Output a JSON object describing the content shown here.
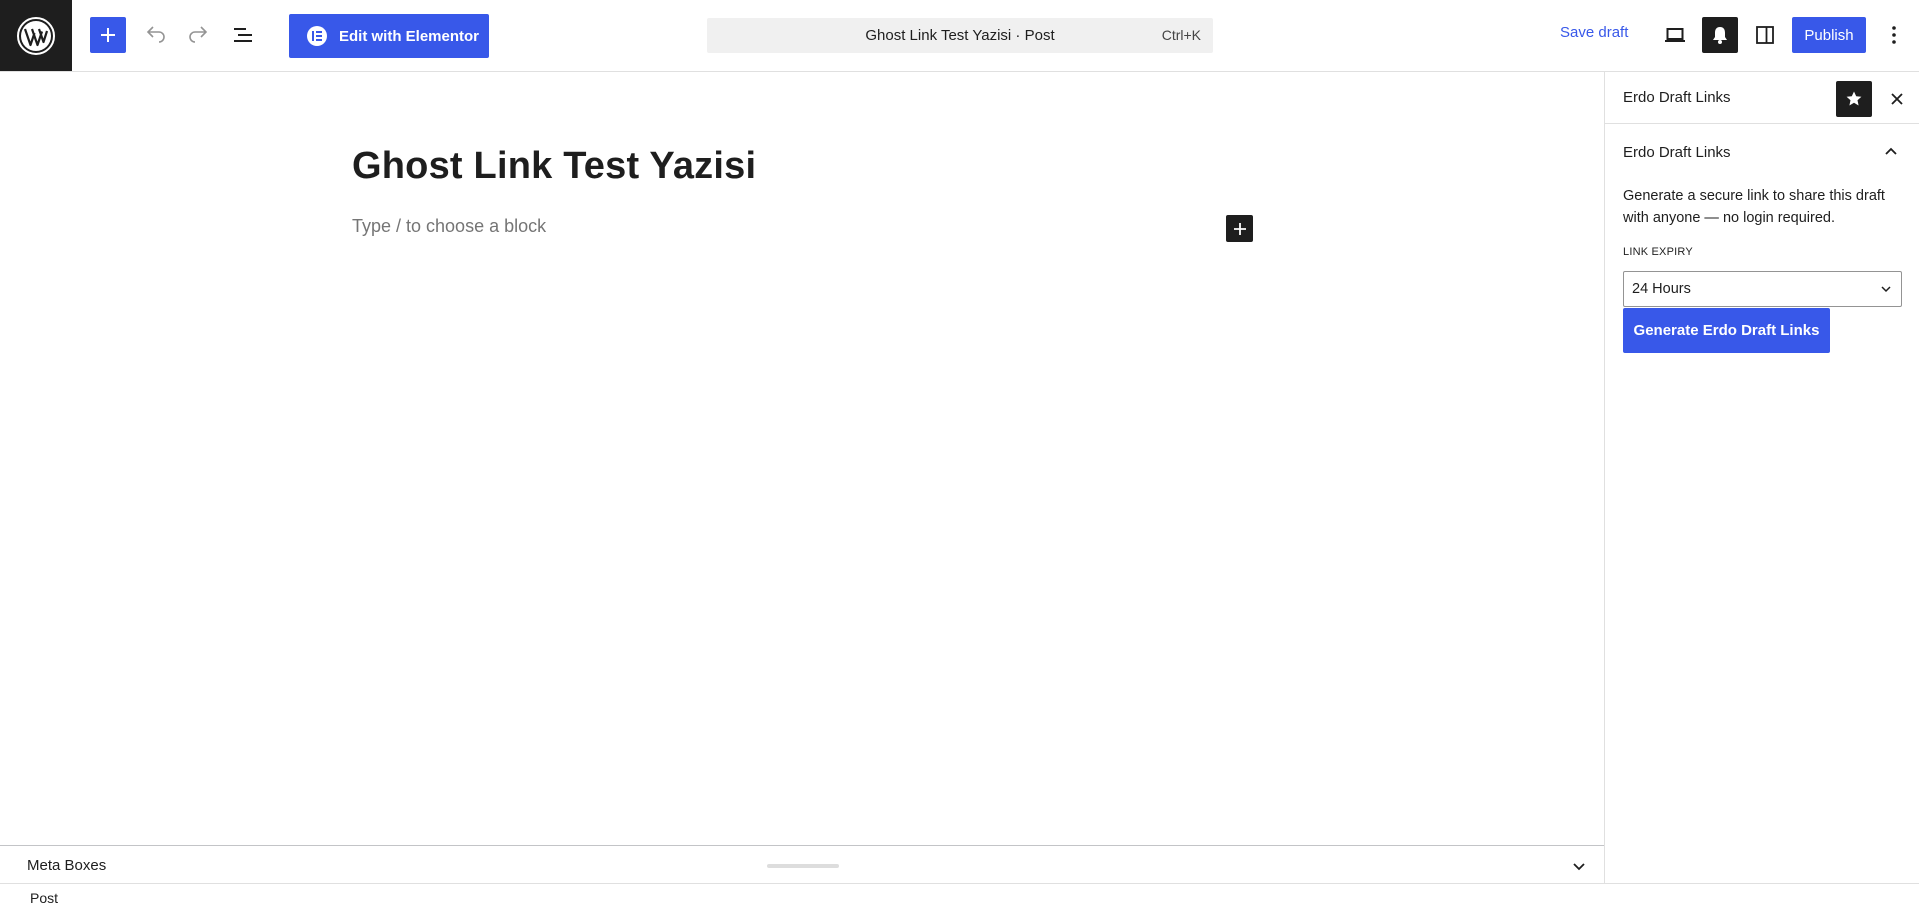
{
  "topbar": {
    "logo_icon": "wordpress-logo-icon",
    "inserter_icon": "plus-icon",
    "undo_icon": "undo-icon",
    "redo_icon": "redo-icon",
    "listview_icon": "list-view-icon",
    "elementor_label": "Edit with Elementor",
    "command_title": "Ghost Link Test Yazisi · Post",
    "command_shortcut": "Ctrl+K",
    "save_draft_label": "Save draft",
    "preview_icon": "laptop-icon",
    "bell_icon": "bell-icon",
    "sidebar_toggle_icon": "sidebar-toggle-icon",
    "publish_label": "Publish",
    "options_icon": "more-vertical-icon"
  },
  "editor": {
    "post_title": "Ghost Link Test Yazisi",
    "block_placeholder": "Type / to choose a block",
    "add_block_icon": "plus-icon"
  },
  "metabox": {
    "label": "Meta Boxes",
    "chevron_icon": "chevron-down-icon"
  },
  "footer": {
    "breadcrumb": "Post"
  },
  "sidebar": {
    "header_title": "Erdo Draft Links",
    "star_icon": "star-icon",
    "close_icon": "close-icon",
    "panel": {
      "title": "Erdo Draft Links",
      "chevron_icon": "chevron-up-icon",
      "description": "Generate a secure link to share this draft with anyone — no login required.",
      "expiry_label": "LINK EXPIRY",
      "expiry_value": "24 Hours",
      "generate_label": "Generate Erdo Draft Links"
    }
  },
  "colors": {
    "accent": "#3858e9",
    "dark": "#1e1e1e",
    "placeholder": "#757575",
    "surface": "#f0f0f0"
  }
}
